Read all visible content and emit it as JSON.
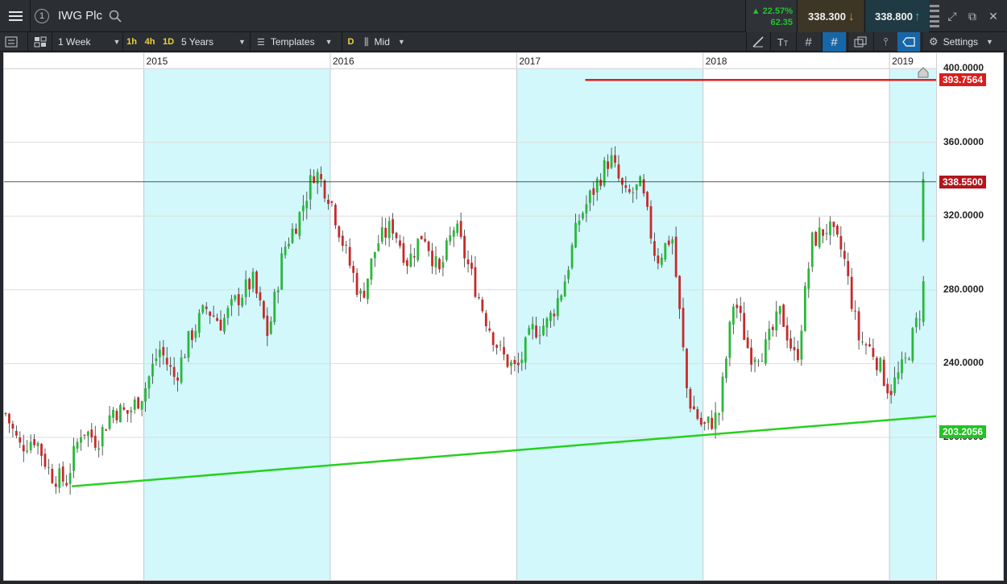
{
  "header": {
    "title": "IWG Plc",
    "link_number": "1",
    "change_pct": "▲ 22.57%",
    "change_abs": "62.35",
    "sell_price": "338.300",
    "buy_price": "338.800",
    "sell_color": "#e8a036",
    "buy_color": "#3ab8d8",
    "up_color": "#27c12e"
  },
  "toolbar": {
    "interval": "1 Week",
    "intervals_quick": [
      "1h",
      "4h",
      "1D"
    ],
    "range": "5 Years",
    "templates_label": "Templates",
    "d_label": "D",
    "price_type": "Mid",
    "settings_label": "Settings"
  },
  "chart_data": {
    "type": "candlestick",
    "title": "",
    "x_range": [
      "2014-04",
      "2019-03"
    ],
    "ylim": [
      155,
      405
    ],
    "y_ticks": [
      200,
      240,
      280,
      320,
      360,
      400
    ],
    "y_tick_labels": [
      "200.0000",
      "240.0000",
      "280.0000",
      "320.0000",
      "360.0000",
      "400.0000"
    ],
    "year_labels": [
      "2015",
      "2016",
      "2017",
      "2018",
      "2019"
    ],
    "up_color": "#2ab73b",
    "down_color": "#c62b2b",
    "current_price": "338.5500",
    "current_price_value": 338.55,
    "resistance_label": "393.7564",
    "resistance_value": 393.7564,
    "support_label": "203.2056",
    "support_value": 203.2056,
    "support_line": {
      "start": [
        "2014-08",
        173.5
      ],
      "end": [
        "2019-03",
        211.5
      ]
    },
    "line_colors": {
      "resistance": "#e02020",
      "support": "#27d020",
      "current": "#222222"
    },
    "waypoints": [
      [
        "2014-04",
        215
      ],
      [
        "2014-05",
        195
      ],
      [
        "2014-06",
        200
      ],
      [
        "2014-07",
        180
      ],
      [
        "2014-08",
        176
      ],
      [
        "2014-09",
        205
      ],
      [
        "2014-10",
        198
      ],
      [
        "2014-11",
        215
      ],
      [
        "2014-12",
        213
      ],
      [
        "2015-01",
        225
      ],
      [
        "2015-02",
        248
      ],
      [
        "2015-03",
        232
      ],
      [
        "2015-04",
        255
      ],
      [
        "2015-05",
        270
      ],
      [
        "2015-06",
        262
      ],
      [
        "2015-07",
        275
      ],
      [
        "2015-08",
        285
      ],
      [
        "2015-09",
        255
      ],
      [
        "2015-10",
        302
      ],
      [
        "2015-11",
        320
      ],
      [
        "2015-12",
        345
      ],
      [
        "2016-01",
        330
      ],
      [
        "2016-02",
        300
      ],
      [
        "2016-03",
        275
      ],
      [
        "2016-04",
        305
      ],
      [
        "2016-05",
        315
      ],
      [
        "2016-06",
        295
      ],
      [
        "2016-07",
        312
      ],
      [
        "2016-08",
        288
      ],
      [
        "2016-09",
        315
      ],
      [
        "2016-10",
        290
      ],
      [
        "2016-11",
        265
      ],
      [
        "2016-12",
        245
      ],
      [
        "2017-01",
        236
      ],
      [
        "2017-02",
        258
      ],
      [
        "2017-03",
        262
      ],
      [
        "2017-04",
        282
      ],
      [
        "2017-05",
        318
      ],
      [
        "2017-06",
        335
      ],
      [
        "2017-07",
        352
      ],
      [
        "2017-08",
        330
      ],
      [
        "2017-09",
        336
      ],
      [
        "2017-10",
        296
      ],
      [
        "2017-11",
        310
      ],
      [
        "2017-12",
        222
      ],
      [
        "2018-01",
        205
      ],
      [
        "2018-02",
        212
      ],
      [
        "2018-03",
        276
      ],
      [
        "2018-04",
        245
      ],
      [
        "2018-05",
        248
      ],
      [
        "2018-06",
        268
      ],
      [
        "2018-07",
        240
      ],
      [
        "2018-08",
        306
      ],
      [
        "2018-09",
        314
      ],
      [
        "2018-10",
        300
      ],
      [
        "2018-11",
        254
      ],
      [
        "2018-12",
        246
      ],
      [
        "2019-01",
        225
      ],
      [
        "2019-02",
        240
      ],
      [
        "2019-03",
        270
      ],
      [
        "2019-04",
        340
      ]
    ]
  }
}
